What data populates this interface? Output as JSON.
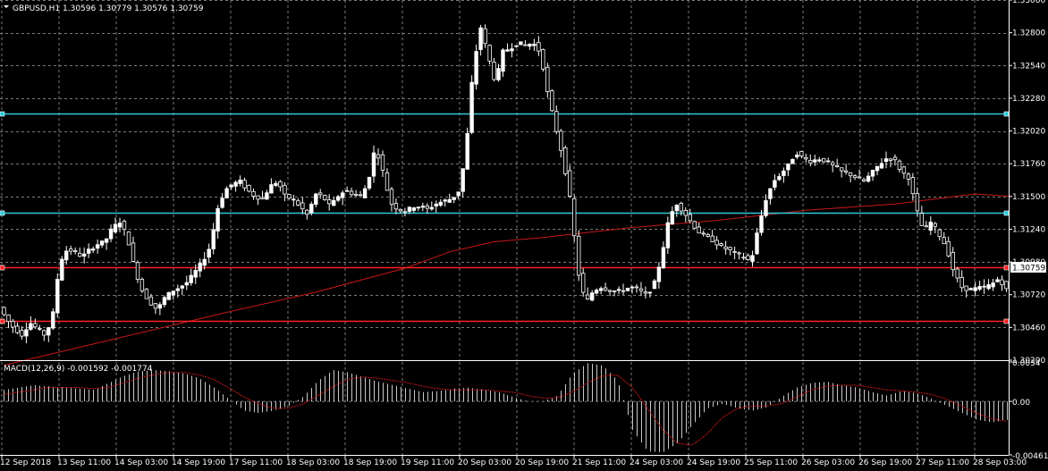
{
  "chart_data": {
    "type": "candlestick",
    "symbol_header": "GBPUSD,H1",
    "ohlc_header": "1.30596 1.30779 1.30576 1.30759",
    "last_price_label": "1.30759",
    "last_price": 1.30759,
    "price_axis": {
      "min": 1.302,
      "max": 1.3306,
      "ticks": [
        "1.33060",
        "1.32800",
        "1.32540",
        "1.32280",
        "1.32020",
        "1.31760",
        "1.31500",
        "1.31240",
        "1.30980",
        "1.30720",
        "1.30460",
        "1.30200"
      ]
    },
    "x_labels": [
      "12 Sep 2018",
      "13 Sep 11:00",
      "14 Sep 03:00",
      "14 Sep 19:00",
      "17 Sep 11:00",
      "18 Sep 03:00",
      "18 Sep 19:00",
      "19 Sep 11:00",
      "20 Sep 03:00",
      "20 Sep 19:00",
      "21 Sep 11:00",
      "24 Sep 03:00",
      "24 Sep 19:00",
      "25 Sep 11:00",
      "26 Sep 03:00",
      "26 Sep 19:00",
      "27 Sep 11:00",
      "28 Sep 03:00"
    ],
    "horizontal_lines": [
      {
        "price": 1.3216,
        "color": "#2ec8d8"
      },
      {
        "price": 1.3137,
        "color": "#2ec8d8"
      },
      {
        "price": 1.3094,
        "color": "#ff2020"
      },
      {
        "price": 1.3051,
        "color": "#ff2020"
      }
    ],
    "moving_average": {
      "color": "#c81818",
      "points": [
        [
          0,
          1.3016
        ],
        [
          50,
          1.3058
        ],
        [
          70,
          1.3074
        ],
        [
          90,
          1.3093
        ],
        [
          100,
          1.3106
        ],
        [
          110,
          1.3114
        ],
        [
          120,
          1.3117
        ],
        [
          140,
          1.3125
        ],
        [
          160,
          1.3131
        ],
        [
          180,
          1.3139
        ],
        [
          200,
          1.3144
        ],
        [
          218,
          1.3152
        ],
        [
          226,
          1.315
        ]
      ]
    },
    "price_path": [
      1.3062,
      1.3052,
      1.3045,
      1.304,
      1.305,
      1.3045,
      1.304,
      1.3052,
      1.3098,
      1.3108,
      1.3106,
      1.3102,
      1.3108,
      1.3112,
      1.3114,
      1.3125,
      1.313,
      1.3118,
      1.3092,
      1.3075,
      1.3066,
      1.306,
      1.307,
      1.3075,
      1.3078,
      1.3082,
      1.309,
      1.3098,
      1.311,
      1.314,
      1.3155,
      1.316,
      1.3162,
      1.3155,
      1.315,
      1.3148,
      1.3158,
      1.3162,
      1.315,
      1.3148,
      1.3142,
      1.3135,
      1.3152,
      1.315,
      1.3142,
      1.315,
      1.3155,
      1.3152,
      1.315,
      1.316,
      1.319,
      1.317,
      1.3145,
      1.314,
      1.3138,
      1.3142,
      1.3142,
      1.314,
      1.3144,
      1.3146,
      1.3148,
      1.3152,
      1.3182,
      1.325,
      1.3285,
      1.3262,
      1.324,
      1.3265,
      1.3268,
      1.3272,
      1.327,
      1.3272,
      1.3264,
      1.323,
      1.3205,
      1.318,
      1.3145,
      1.309,
      1.3065,
      1.3075,
      1.3078,
      1.3076,
      1.3074,
      1.3076,
      1.3078,
      1.3076,
      1.3072,
      1.3078,
      1.31,
      1.313,
      1.3145,
      1.3138,
      1.313,
      1.3122,
      1.3118,
      1.3115,
      1.311,
      1.3108,
      1.3104,
      1.3102,
      1.3098,
      1.3126,
      1.3148,
      1.3162,
      1.3168,
      1.3175,
      1.3185,
      1.318,
      1.3178,
      1.318,
      1.3178,
      1.3174,
      1.317,
      1.3168,
      1.3165,
      1.3162,
      1.3168,
      1.3175,
      1.318,
      1.318,
      1.317,
      1.3165,
      1.314,
      1.3122,
      1.313,
      1.312,
      1.311,
      1.309,
      1.3078,
      1.3076,
      1.3077,
      1.3078,
      1.308,
      1.3085,
      1.3076
    ],
    "macd": {
      "label": "MACD(12,26,9) -0.001592 -0.001774",
      "axis_ticks": [
        "0.0034",
        "0.00",
        "-0.004615"
      ],
      "min": -0.004615,
      "max": 0.0034,
      "histogram_color": "#c8c8c8",
      "signal_color": "#c81818",
      "histogram": [
        0.001,
        0.0012,
        0.0014,
        0.0013,
        0.0012,
        0.0011,
        0.001,
        0.0016,
        0.0022,
        0.0026,
        0.0027,
        0.0026,
        0.0024,
        0.002,
        0.0012,
        0.0002,
        -0.0008,
        -0.001,
        -0.0008,
        -0.0004,
        0.0004,
        0.0018,
        0.0027,
        0.0025,
        0.0021,
        0.0017,
        0.0014,
        0.0011,
        0.0008,
        0.0009,
        0.0011,
        0.0012,
        0.001,
        0.0008,
        0.0004,
        0.0,
        0.0,
        0.0005,
        0.0024,
        0.0033,
        0.0031,
        0.0018,
        -0.0025,
        -0.0043,
        -0.0044,
        -0.0036,
        -0.002,
        -0.0006,
        -0.0002,
        -0.0006,
        -0.0008,
        -0.0005,
        0.0004,
        0.0012,
        0.0016,
        0.0017,
        0.0014,
        0.0012,
        0.0008,
        0.0005,
        0.0009,
        0.0007,
        0.0002,
        -0.0004,
        -0.001,
        -0.0016,
        -0.0018,
        -0.0016
      ],
      "signal": [
        0.0006,
        0.0008,
        0.001,
        0.0012,
        0.0012,
        0.0012,
        0.0011,
        0.0012,
        0.0016,
        0.002,
        0.0023,
        0.0025,
        0.0025,
        0.0023,
        0.0019,
        0.0012,
        0.0004,
        -0.0002,
        -0.0006,
        -0.0006,
        -0.0002,
        0.0005,
        0.0013,
        0.0019,
        0.0021,
        0.002,
        0.0018,
        0.0016,
        0.0013,
        0.0011,
        0.001,
        0.001,
        0.001,
        0.0009,
        0.0008,
        0.0005,
        0.0003,
        0.0003,
        0.0008,
        0.0016,
        0.0022,
        0.0023,
        0.0012,
        -0.0006,
        -0.0024,
        -0.0036,
        -0.0038,
        -0.0028,
        -0.0014,
        -0.0006,
        -0.0004,
        -0.0004,
        -0.0002,
        0.0004,
        0.001,
        0.0013,
        0.0014,
        0.0014,
        0.0012,
        0.001,
        0.0009,
        0.0008,
        0.0006,
        0.0002,
        -0.0004,
        -0.001,
        -0.0015,
        -0.0017
      ]
    }
  },
  "colors": {
    "background": "#000000",
    "grid": "#7a7a7a",
    "bull_candle": "#ffffff",
    "bear_candle": "#000000",
    "wick": "#ffffff",
    "text": "#ffffff"
  }
}
